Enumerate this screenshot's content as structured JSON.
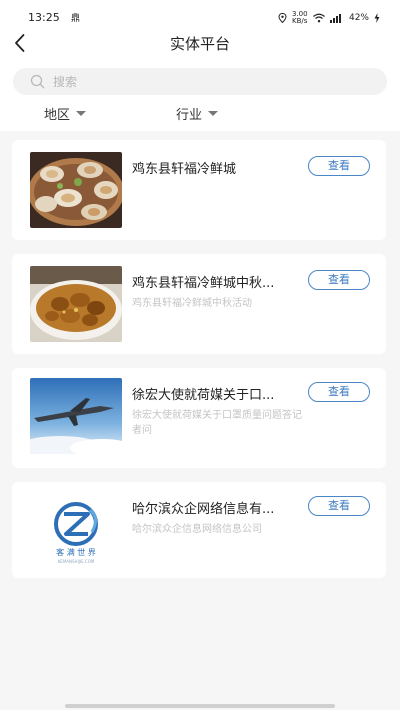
{
  "status_bar": {
    "time": "13:25",
    "time_icon": "鼎",
    "net_speed": "3.00 KB/s",
    "battery": "42%"
  },
  "nav": {
    "title": "实体平台",
    "back_icon": "chevron-left-icon"
  },
  "search": {
    "placeholder": "搜索",
    "icon": "search-icon"
  },
  "filters": {
    "region_label": "地区",
    "industry_label": "行业"
  },
  "cards": [
    {
      "title": "鸡东县轩福冷鲜城",
      "description": "",
      "button_label": "查看",
      "thumb": "seafood-platter"
    },
    {
      "title": "鸡东县轩福冷鲜城中秋...",
      "description": "鸡东县轩福冷鲜城中秋活动",
      "button_label": "查看",
      "thumb": "braised-dish"
    },
    {
      "title": "徐宏大使就荷媒关于口...",
      "description": "徐宏大使就荷媒关于口罩质量问题答记者问",
      "button_label": "查看",
      "thumb": "airplane-sky"
    },
    {
      "title": "哈尔滨众企网络信息有...",
      "description": "哈尔滨众企信息网络信息公司",
      "button_label": "查看",
      "thumb": "company-logo",
      "logo_text": "客 满 世 界",
      "logo_subtext": "KEMANSHIJIE.COM"
    }
  ],
  "colors": {
    "accent": "#3d7bc1",
    "page_bg": "#f6f6f6",
    "card_bg": "#ffffff"
  }
}
